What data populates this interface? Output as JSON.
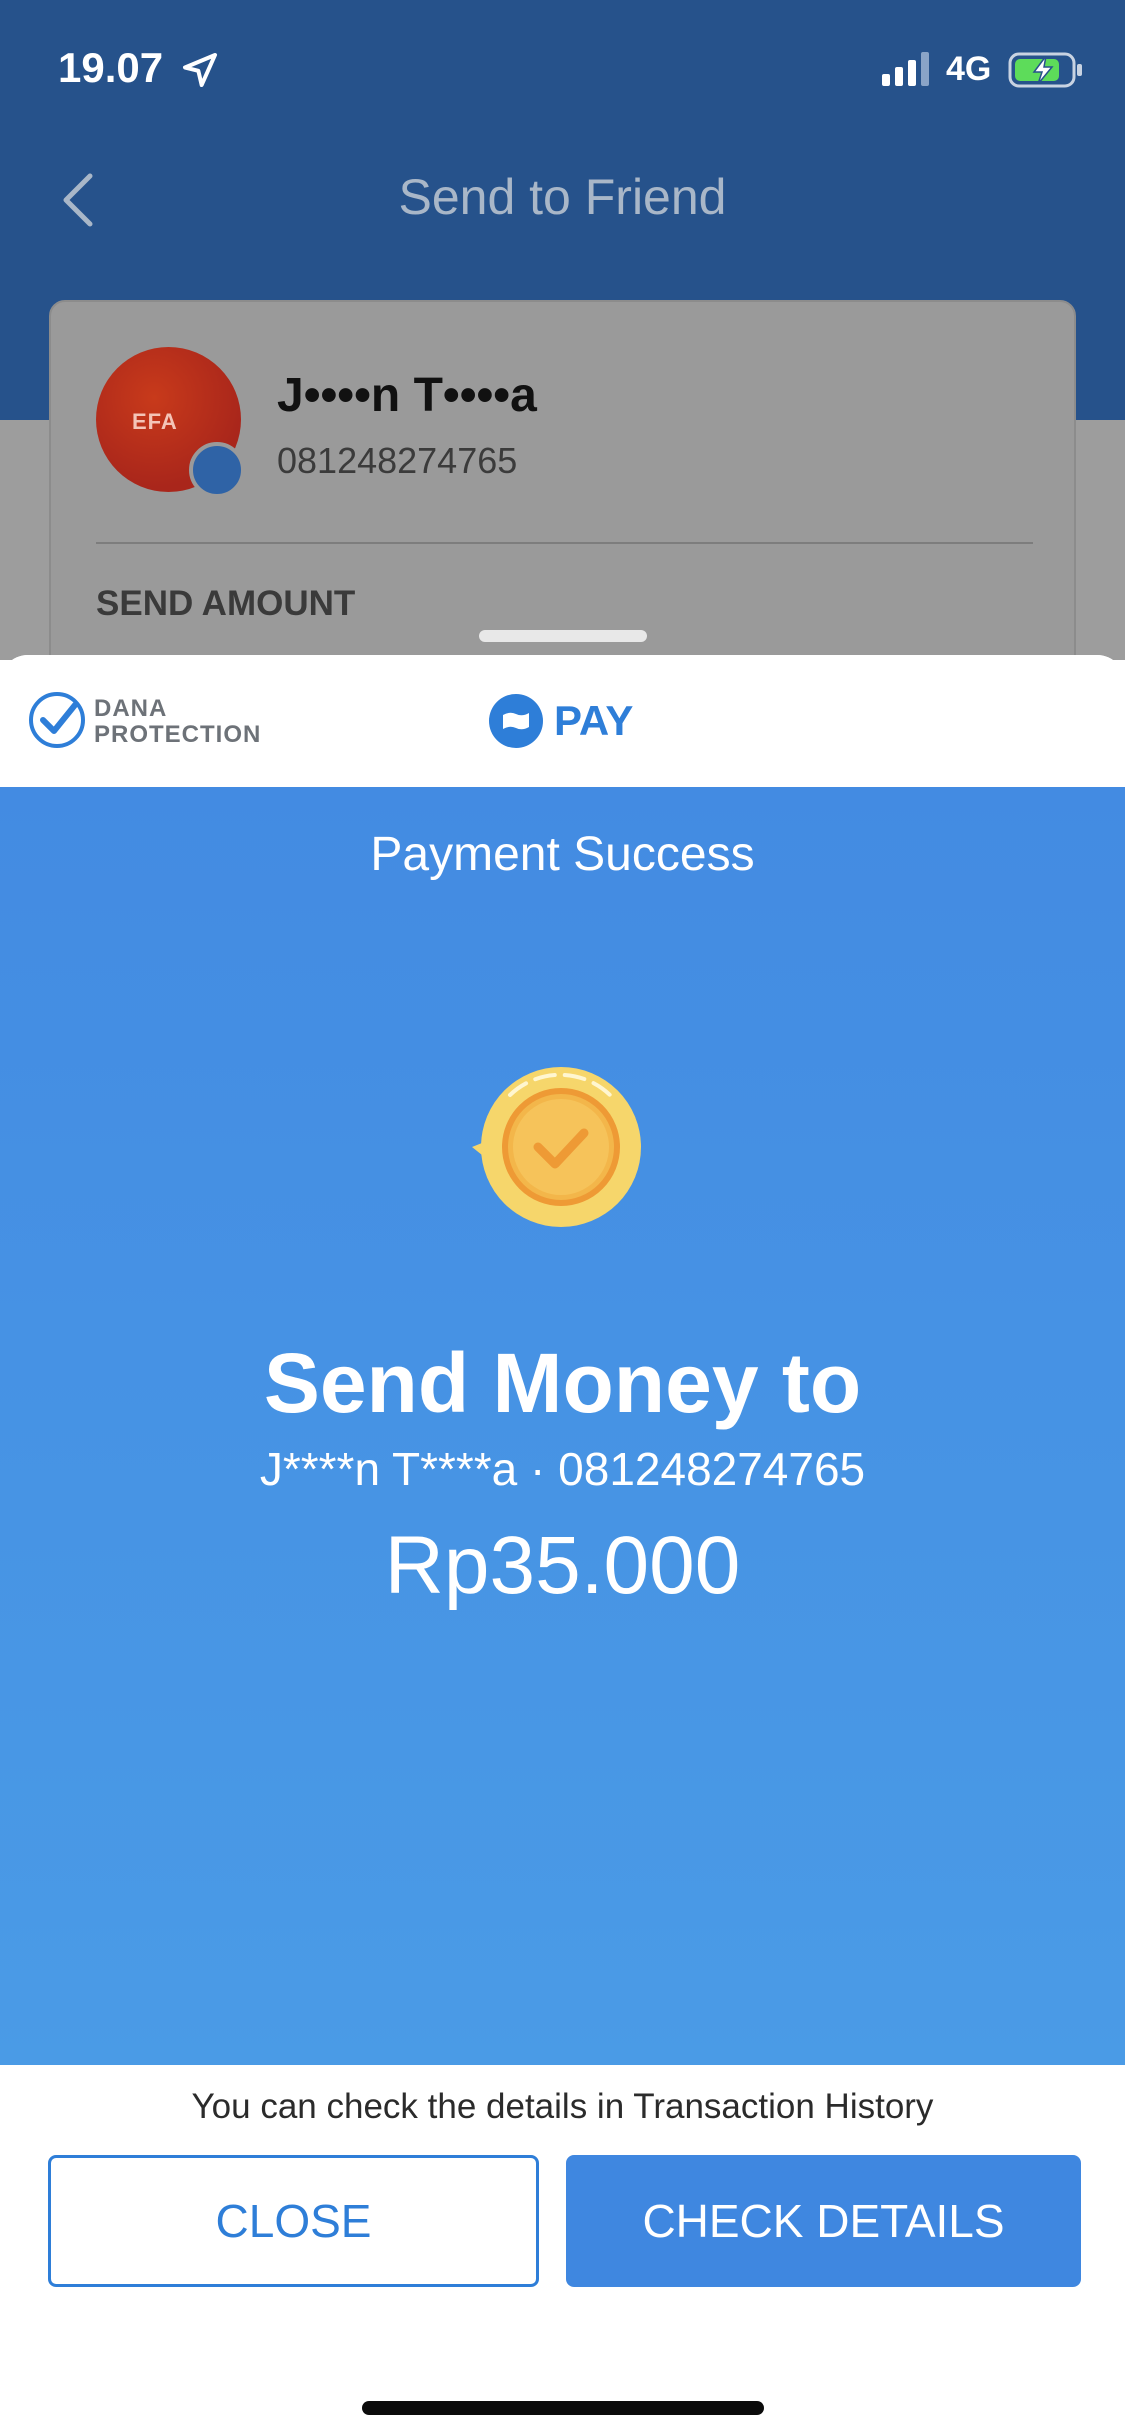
{
  "status_bar": {
    "time": "19.07",
    "network": "4G"
  },
  "background_screen": {
    "title": "Send to Friend",
    "recipient": {
      "avatar_text": "EFA",
      "name": "J••••n T••••a",
      "phone": "081248274765"
    },
    "section_label": "SEND AMOUNT"
  },
  "sheet": {
    "protection": {
      "line1": "DANA",
      "line2": "PROTECTION"
    },
    "pay_label": "PAY",
    "success_title": "Payment Success",
    "heading": "Send Money to",
    "recipient_line": "J****n T****a · 081248274765",
    "amount": "Rp35.000",
    "info": "You can check the details in Transaction History",
    "close_label": "CLOSE",
    "check_label": "CHECK DETAILS"
  },
  "colors": {
    "header_bg": "#26528b",
    "accent": "#2e7ed8",
    "success_bg": "#438be2",
    "coin": "#f6d66b"
  },
  "icons": [
    "location-arrow-icon",
    "signal-icon",
    "battery-charging-icon",
    "back-chevron-icon",
    "dana-shield-icon",
    "pay-logo-icon",
    "success-coin-icon"
  ]
}
